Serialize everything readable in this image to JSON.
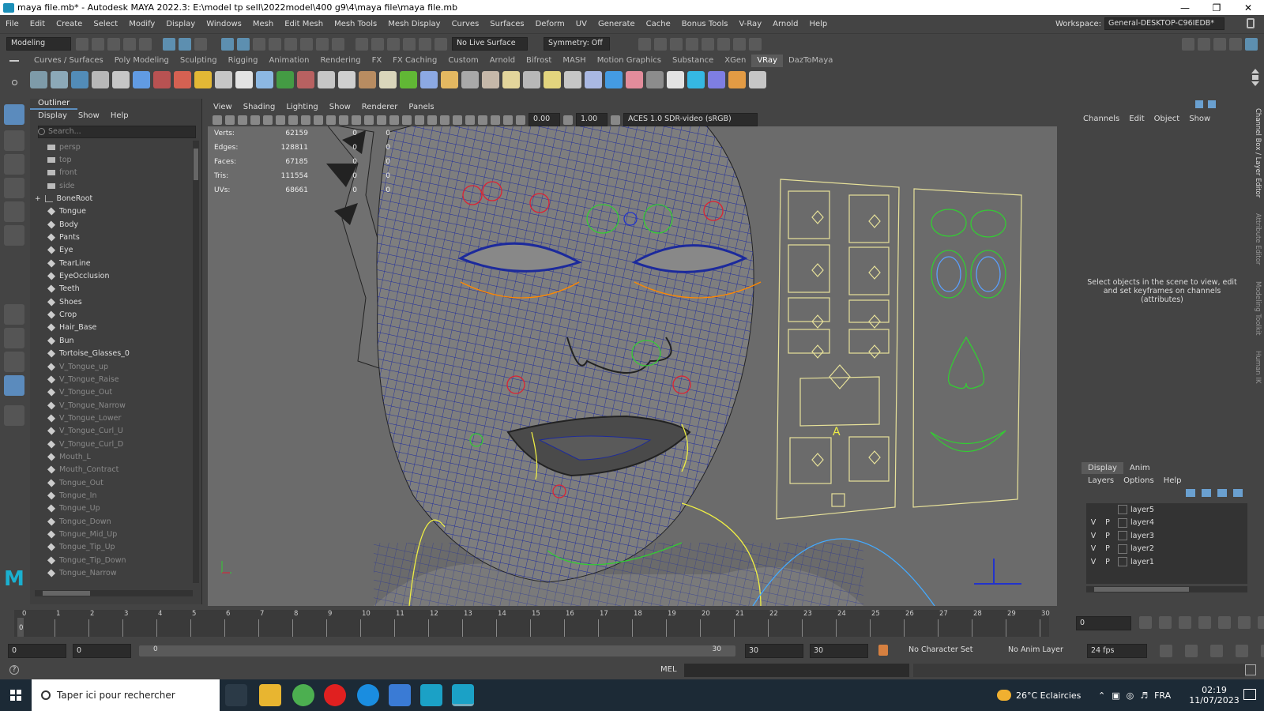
{
  "window": {
    "title": "maya file.mb* - Autodesk MAYA 2022.3: E:\\model tp sell\\2022model\\400 g9\\4\\maya file\\maya file.mb"
  },
  "menubar": {
    "items": [
      "File",
      "Edit",
      "Create",
      "Select",
      "Modify",
      "Display",
      "Windows",
      "Mesh",
      "Edit Mesh",
      "Mesh Tools",
      "Mesh Display",
      "Curves",
      "Surfaces",
      "Deform",
      "UV",
      "Generate",
      "Cache",
      "Bonus Tools",
      "V-Ray",
      "Arnold",
      "Help"
    ],
    "workspace_label": "Workspace:",
    "workspace_value": "General-DESKTOP-C96IEDB*"
  },
  "statusline": {
    "mode": "Modeling",
    "live_surface": "No Live Surface",
    "symmetry": "Symmetry: Off"
  },
  "shelf": {
    "tabs": [
      "Curves / Surfaces",
      "Poly Modeling",
      "Sculpting",
      "Rigging",
      "Animation",
      "Rendering",
      "FX",
      "FX Caching",
      "Custom",
      "Arnold",
      "Bifrost",
      "MASH",
      "Motion Graphics",
      "Substance",
      "XGen",
      "VRay",
      "DazToMaya"
    ],
    "active_tab": "VRay"
  },
  "outliner": {
    "title": "Outliner",
    "menu": [
      "Display",
      "Show",
      "Help"
    ],
    "search_placeholder": "Search...",
    "items": [
      {
        "label": "persp",
        "dim": true,
        "type": "camera"
      },
      {
        "label": "top",
        "dim": true,
        "type": "camera"
      },
      {
        "label": "front",
        "dim": true,
        "type": "camera"
      },
      {
        "label": "side",
        "dim": true,
        "type": "camera"
      },
      {
        "label": "BoneRoot",
        "dim": false,
        "type": "joint"
      },
      {
        "label": "Tongue",
        "dim": false,
        "type": "mesh"
      },
      {
        "label": "Body",
        "dim": false,
        "type": "mesh"
      },
      {
        "label": "Pants",
        "dim": false,
        "type": "mesh"
      },
      {
        "label": "Eye",
        "dim": false,
        "type": "mesh"
      },
      {
        "label": "TearLine",
        "dim": false,
        "type": "mesh"
      },
      {
        "label": "EyeOcclusion",
        "dim": false,
        "type": "mesh"
      },
      {
        "label": "Teeth",
        "dim": false,
        "type": "mesh"
      },
      {
        "label": "Shoes",
        "dim": false,
        "type": "mesh"
      },
      {
        "label": "Crop",
        "dim": false,
        "type": "mesh"
      },
      {
        "label": "Hair_Base",
        "dim": false,
        "type": "mesh"
      },
      {
        "label": "Bun",
        "dim": false,
        "type": "mesh"
      },
      {
        "label": "Tortoise_Glasses_0",
        "dim": false,
        "type": "mesh"
      },
      {
        "label": "V_Tongue_up",
        "dim": true,
        "type": "mesh"
      },
      {
        "label": "V_Tongue_Raise",
        "dim": true,
        "type": "mesh"
      },
      {
        "label": "V_Tongue_Out",
        "dim": true,
        "type": "mesh"
      },
      {
        "label": "V_Tongue_Narrow",
        "dim": true,
        "type": "mesh"
      },
      {
        "label": "V_Tongue_Lower",
        "dim": true,
        "type": "mesh"
      },
      {
        "label": "V_Tongue_Curl_U",
        "dim": true,
        "type": "mesh"
      },
      {
        "label": "V_Tongue_Curl_D",
        "dim": true,
        "type": "mesh"
      },
      {
        "label": "Mouth_L",
        "dim": true,
        "type": "mesh"
      },
      {
        "label": "Mouth_Contract",
        "dim": true,
        "type": "mesh"
      },
      {
        "label": "Tongue_Out",
        "dim": true,
        "type": "mesh"
      },
      {
        "label": "Tongue_In",
        "dim": true,
        "type": "mesh"
      },
      {
        "label": "Tongue_Up",
        "dim": true,
        "type": "mesh"
      },
      {
        "label": "Tongue_Down",
        "dim": true,
        "type": "mesh"
      },
      {
        "label": "Tongue_Mid_Up",
        "dim": true,
        "type": "mesh"
      },
      {
        "label": "Tongue_Tip_Up",
        "dim": true,
        "type": "mesh"
      },
      {
        "label": "Tongue_Tip_Down",
        "dim": true,
        "type": "mesh"
      },
      {
        "label": "Tongue_Narrow",
        "dim": true,
        "type": "mesh"
      }
    ]
  },
  "viewport": {
    "menu": [
      "View",
      "Shading",
      "Lighting",
      "Show",
      "Renderer",
      "Panels"
    ],
    "exposure": "0.00",
    "gamma": "1.00",
    "colorspace": "ACES 1.0 SDR-video (sRGB)",
    "hud": [
      {
        "label": "Verts:",
        "a": "62159",
        "b": "0",
        "c": "0"
      },
      {
        "label": "Edges:",
        "a": "128811",
        "b": "0",
        "c": "0"
      },
      {
        "label": "Faces:",
        "a": "67185",
        "b": "0",
        "c": "0"
      },
      {
        "label": "Tris:",
        "a": "111554",
        "b": "0",
        "c": "0"
      },
      {
        "label": "UVs:",
        "a": "68661",
        "b": "0",
        "c": "0"
      }
    ],
    "panel_letter": "A"
  },
  "channelbox": {
    "menu": [
      "Channels",
      "Edit",
      "Object",
      "Show"
    ],
    "message": "Select objects in the scene to view, edit and set keyframes on channels (attributes)",
    "side_tabs": [
      "Channel Box / Layer Editor",
      "Attribute Editor",
      "Modeling Toolkit",
      "Human IK"
    ]
  },
  "layers": {
    "tabs": [
      "Display",
      "Anim"
    ],
    "menu": [
      "Layers",
      "Options",
      "Help"
    ],
    "rows": [
      {
        "v": "",
        "p": "",
        "name": "layer5"
      },
      {
        "v": "V",
        "p": "P",
        "name": "layer4"
      },
      {
        "v": "V",
        "p": "P",
        "name": "layer3"
      },
      {
        "v": "V",
        "p": "P",
        "name": "layer2"
      },
      {
        "v": "V",
        "p": "P",
        "name": "layer1"
      }
    ]
  },
  "timeline": {
    "ticks": [
      "0",
      "1",
      "2",
      "3",
      "4",
      "5",
      "6",
      "7",
      "8",
      "9",
      "10",
      "11",
      "12",
      "13",
      "14",
      "15",
      "16",
      "17",
      "18",
      "19",
      "20",
      "21",
      "22",
      "23",
      "24",
      "25",
      "26",
      "27",
      "28",
      "29",
      "30"
    ],
    "current_frame": "0",
    "frame_field": "0"
  },
  "range": {
    "start": "0",
    "start_inner": "0",
    "slider_start": "0",
    "slider_end": "30",
    "end_inner": "30",
    "end": "30",
    "character_set": "No Character Set",
    "anim_layer": "No Anim Layer",
    "fps": "24 fps"
  },
  "commandline": {
    "lang": "MEL"
  },
  "taskbar": {
    "search_placeholder": "Taper ici pour rechercher",
    "weather": "26°C Eclaircies",
    "lang": "FRA",
    "time": "02:19",
    "date": "11/07/2023"
  }
}
